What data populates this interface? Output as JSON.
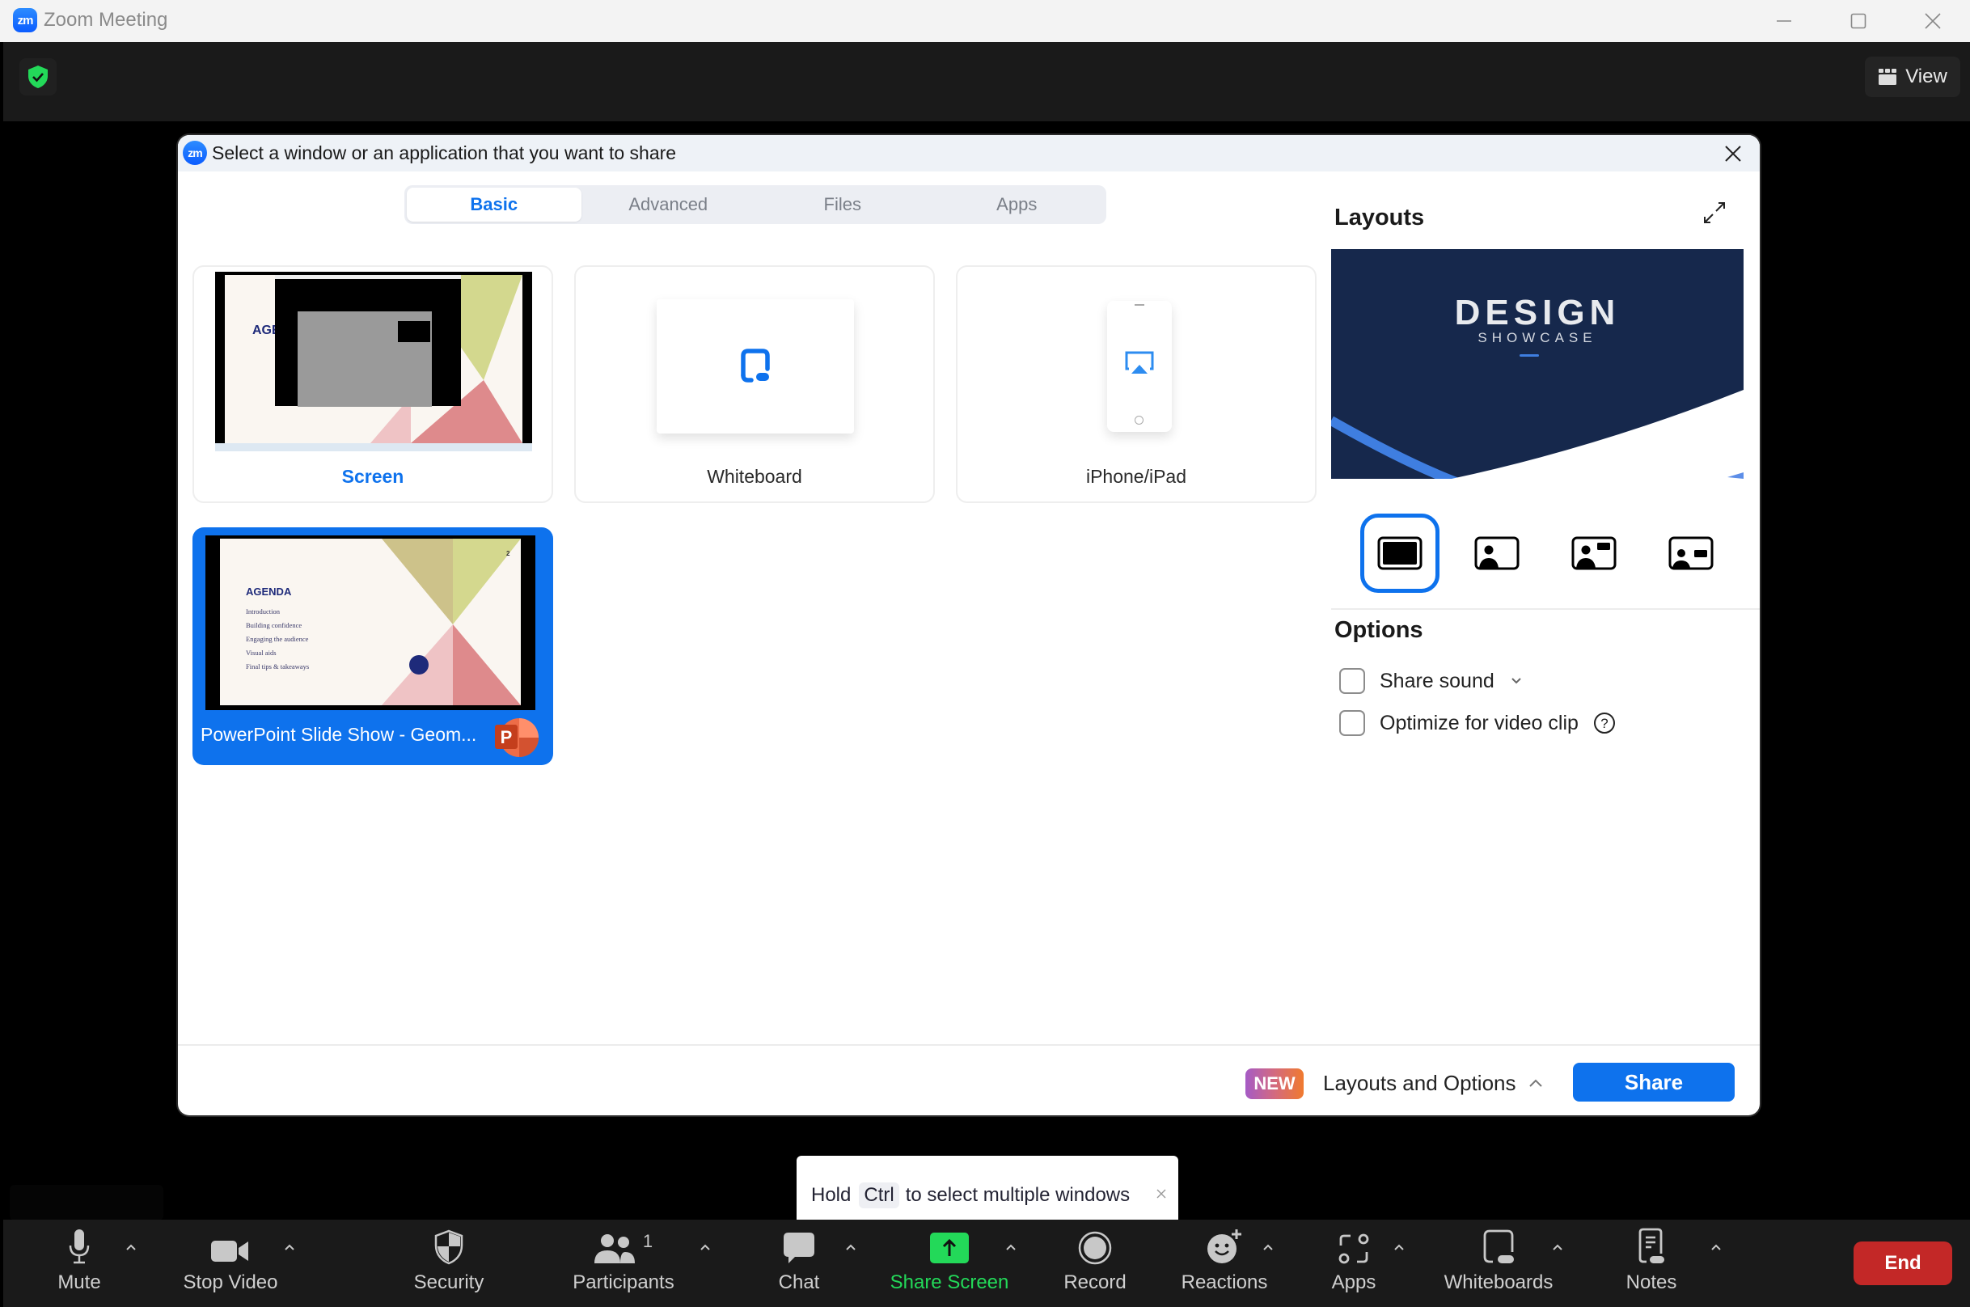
{
  "window": {
    "title": "Zoom Meeting",
    "logo_text": "zm"
  },
  "meeting_header": {
    "view_label": "View"
  },
  "dialog": {
    "title": "Select a window or an application that you want to share",
    "logo_text": "zm",
    "tabs": [
      {
        "label": "Basic",
        "active": true
      },
      {
        "label": "Advanced",
        "active": false
      },
      {
        "label": "Files",
        "active": false
      },
      {
        "label": "Apps",
        "active": false
      }
    ],
    "cards": {
      "screen": {
        "label": "Screen"
      },
      "whiteboard": {
        "label": "Whiteboard"
      },
      "iphone": {
        "label": "iPhone/iPad"
      },
      "powerpoint": {
        "label": "PowerPoint Slide Show  -  Geom...",
        "selected": true,
        "app_icon_letter": "P"
      }
    },
    "slide_preview": {
      "heading": "AGENDA",
      "items": [
        "Introduction",
        "Building confidence",
        "Engaging the audience",
        "Visual aids",
        "Final tips & takeaways"
      ],
      "page_number": "2"
    },
    "layouts": {
      "title": "Layouts",
      "preview_title": "DESIGN",
      "preview_subtitle": "SHOWCASE",
      "options": [
        {
          "name": "content-only",
          "selected": true
        },
        {
          "name": "video-left",
          "selected": false
        },
        {
          "name": "video-left-with-badge",
          "selected": false
        },
        {
          "name": "video-small-with-badge",
          "selected": false
        }
      ]
    },
    "options": {
      "title": "Options",
      "share_sound": {
        "label": "Share sound",
        "checked": false
      },
      "optimize_video": {
        "label": "Optimize for video clip",
        "checked": false
      }
    },
    "footer": {
      "new_badge": "NEW",
      "layouts_options_label": "Layouts and Options",
      "share_label": "Share"
    }
  },
  "tooltip": {
    "prefix": "Hold",
    "key": "Ctrl",
    "suffix": "to select multiple windows"
  },
  "toolbar": {
    "items": [
      {
        "label": "Mute"
      },
      {
        "label": "Stop Video"
      },
      {
        "label": "Security"
      },
      {
        "label": "Participants",
        "count": "1"
      },
      {
        "label": "Chat"
      },
      {
        "label": "Share Screen",
        "active_color": "#23d959"
      },
      {
        "label": "Record"
      },
      {
        "label": "Reactions"
      },
      {
        "label": "Apps"
      },
      {
        "label": "Whiteboards"
      },
      {
        "label": "Notes"
      }
    ],
    "end_label": "End"
  },
  "colors": {
    "accent": "#0e72ed",
    "share_green": "#23d959",
    "end_red": "#c32827",
    "encryption_green": "#23d959"
  }
}
